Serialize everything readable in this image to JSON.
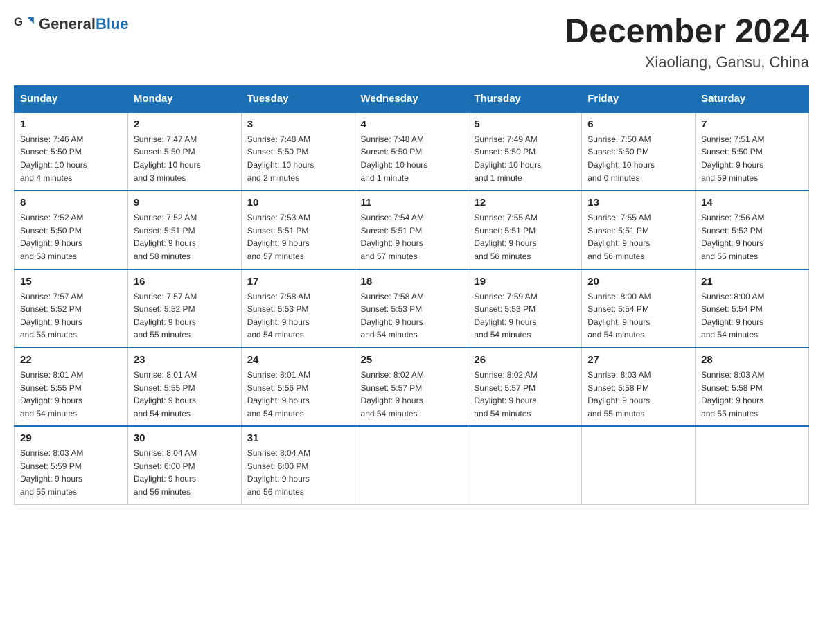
{
  "header": {
    "logo_general": "General",
    "logo_blue": "Blue",
    "month_title": "December 2024",
    "location": "Xiaoliang, Gansu, China"
  },
  "days_of_week": [
    "Sunday",
    "Monday",
    "Tuesday",
    "Wednesday",
    "Thursday",
    "Friday",
    "Saturday"
  ],
  "weeks": [
    [
      {
        "day": "1",
        "sunrise": "7:46 AM",
        "sunset": "5:50 PM",
        "daylight": "10 hours and 4 minutes."
      },
      {
        "day": "2",
        "sunrise": "7:47 AM",
        "sunset": "5:50 PM",
        "daylight": "10 hours and 3 minutes."
      },
      {
        "day": "3",
        "sunrise": "7:48 AM",
        "sunset": "5:50 PM",
        "daylight": "10 hours and 2 minutes."
      },
      {
        "day": "4",
        "sunrise": "7:48 AM",
        "sunset": "5:50 PM",
        "daylight": "10 hours and 1 minute."
      },
      {
        "day": "5",
        "sunrise": "7:49 AM",
        "sunset": "5:50 PM",
        "daylight": "10 hours and 1 minute."
      },
      {
        "day": "6",
        "sunrise": "7:50 AM",
        "sunset": "5:50 PM",
        "daylight": "10 hours and 0 minutes."
      },
      {
        "day": "7",
        "sunrise": "7:51 AM",
        "sunset": "5:50 PM",
        "daylight": "9 hours and 59 minutes."
      }
    ],
    [
      {
        "day": "8",
        "sunrise": "7:52 AM",
        "sunset": "5:50 PM",
        "daylight": "9 hours and 58 minutes."
      },
      {
        "day": "9",
        "sunrise": "7:52 AM",
        "sunset": "5:51 PM",
        "daylight": "9 hours and 58 minutes."
      },
      {
        "day": "10",
        "sunrise": "7:53 AM",
        "sunset": "5:51 PM",
        "daylight": "9 hours and 57 minutes."
      },
      {
        "day": "11",
        "sunrise": "7:54 AM",
        "sunset": "5:51 PM",
        "daylight": "9 hours and 57 minutes."
      },
      {
        "day": "12",
        "sunrise": "7:55 AM",
        "sunset": "5:51 PM",
        "daylight": "9 hours and 56 minutes."
      },
      {
        "day": "13",
        "sunrise": "7:55 AM",
        "sunset": "5:51 PM",
        "daylight": "9 hours and 56 minutes."
      },
      {
        "day": "14",
        "sunrise": "7:56 AM",
        "sunset": "5:52 PM",
        "daylight": "9 hours and 55 minutes."
      }
    ],
    [
      {
        "day": "15",
        "sunrise": "7:57 AM",
        "sunset": "5:52 PM",
        "daylight": "9 hours and 55 minutes."
      },
      {
        "day": "16",
        "sunrise": "7:57 AM",
        "sunset": "5:52 PM",
        "daylight": "9 hours and 55 minutes."
      },
      {
        "day": "17",
        "sunrise": "7:58 AM",
        "sunset": "5:53 PM",
        "daylight": "9 hours and 54 minutes."
      },
      {
        "day": "18",
        "sunrise": "7:58 AM",
        "sunset": "5:53 PM",
        "daylight": "9 hours and 54 minutes."
      },
      {
        "day": "19",
        "sunrise": "7:59 AM",
        "sunset": "5:53 PM",
        "daylight": "9 hours and 54 minutes."
      },
      {
        "day": "20",
        "sunrise": "8:00 AM",
        "sunset": "5:54 PM",
        "daylight": "9 hours and 54 minutes."
      },
      {
        "day": "21",
        "sunrise": "8:00 AM",
        "sunset": "5:54 PM",
        "daylight": "9 hours and 54 minutes."
      }
    ],
    [
      {
        "day": "22",
        "sunrise": "8:01 AM",
        "sunset": "5:55 PM",
        "daylight": "9 hours and 54 minutes."
      },
      {
        "day": "23",
        "sunrise": "8:01 AM",
        "sunset": "5:55 PM",
        "daylight": "9 hours and 54 minutes."
      },
      {
        "day": "24",
        "sunrise": "8:01 AM",
        "sunset": "5:56 PM",
        "daylight": "9 hours and 54 minutes."
      },
      {
        "day": "25",
        "sunrise": "8:02 AM",
        "sunset": "5:57 PM",
        "daylight": "9 hours and 54 minutes."
      },
      {
        "day": "26",
        "sunrise": "8:02 AM",
        "sunset": "5:57 PM",
        "daylight": "9 hours and 54 minutes."
      },
      {
        "day": "27",
        "sunrise": "8:03 AM",
        "sunset": "5:58 PM",
        "daylight": "9 hours and 55 minutes."
      },
      {
        "day": "28",
        "sunrise": "8:03 AM",
        "sunset": "5:58 PM",
        "daylight": "9 hours and 55 minutes."
      }
    ],
    [
      {
        "day": "29",
        "sunrise": "8:03 AM",
        "sunset": "5:59 PM",
        "daylight": "9 hours and 55 minutes."
      },
      {
        "day": "30",
        "sunrise": "8:04 AM",
        "sunset": "6:00 PM",
        "daylight": "9 hours and 56 minutes."
      },
      {
        "day": "31",
        "sunrise": "8:04 AM",
        "sunset": "6:00 PM",
        "daylight": "9 hours and 56 minutes."
      },
      null,
      null,
      null,
      null
    ]
  ],
  "labels": {
    "sunrise": "Sunrise:",
    "sunset": "Sunset:",
    "daylight": "Daylight:"
  }
}
